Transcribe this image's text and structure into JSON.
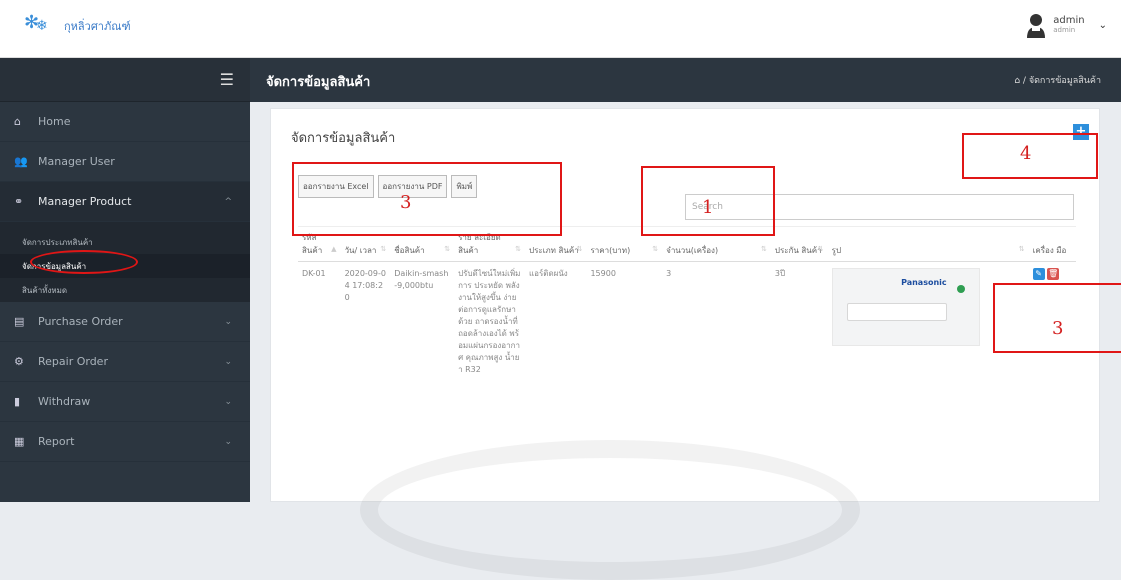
{
  "topbar": {
    "logo_text": "กุหลิ่วศาภัณฑ์",
    "user_name": "admin",
    "user_role": "admin"
  },
  "sidebar": {
    "items": [
      {
        "label": "Home",
        "icon": "home-icon"
      },
      {
        "label": "Manager User",
        "icon": "users-icon"
      },
      {
        "label": "Manager Product",
        "icon": "product-icon"
      },
      {
        "label": "Purchase Order",
        "icon": "list-icon"
      },
      {
        "label": "Repair Order",
        "icon": "gear-icon"
      },
      {
        "label": "Withdraw",
        "icon": "file-icon"
      },
      {
        "label": "Report",
        "icon": "grid-icon"
      }
    ],
    "product_sub": [
      "จัดการประเภทสินค้า",
      "จัดการข้อมูลสินค้า",
      "สินค้าทั้งหมด"
    ]
  },
  "header": {
    "title": "จัดการข้อมูลสินค้า",
    "breadcrumb": "/ จัดการข้อมูลสินค้า"
  },
  "card": {
    "title": "จัดการข้อมูลสินค้า",
    "add_label": "+",
    "export_excel": "ออกรายงาน Excel",
    "export_pdf": "ออกรายงาน PDF",
    "print": "พิมพ์",
    "search_placeholder": "Search"
  },
  "table": {
    "headers": [
      "รหัส สินค้า",
      "วัน/ เวลา",
      "ชื่อสินค้า",
      "ราย ละเอียด สินค้า",
      "ประเภท สินค้า",
      "ราคา(บาท)",
      "จำนวน(เครื่อง)",
      "ประกัน สินค้า",
      "รูป",
      "เครื่อง มือ"
    ],
    "row": {
      "code": "DK-01",
      "datetime": "2020-09-04 17:08:20",
      "name": "Daikin-smash-9,000btu",
      "detail": "ปรับดีไซน์ใหม่เพิ่มการ ประหยัด พลังงานให้สูงขึ้น ง่ายต่อการดูแลรักษาด้วย ถาดรองน้ำที่ถอดล้างเองได้ พร้อมแผ่นกรองอากาศ คุณภาพสูง น้ำยา R32",
      "type": "แอร์ติดผนัง",
      "price": "15900",
      "qty": "3",
      "warranty": "3ปี",
      "image_brand": "Panasonic"
    }
  },
  "annotations": [
    "1",
    "3",
    "3",
    "4"
  ]
}
